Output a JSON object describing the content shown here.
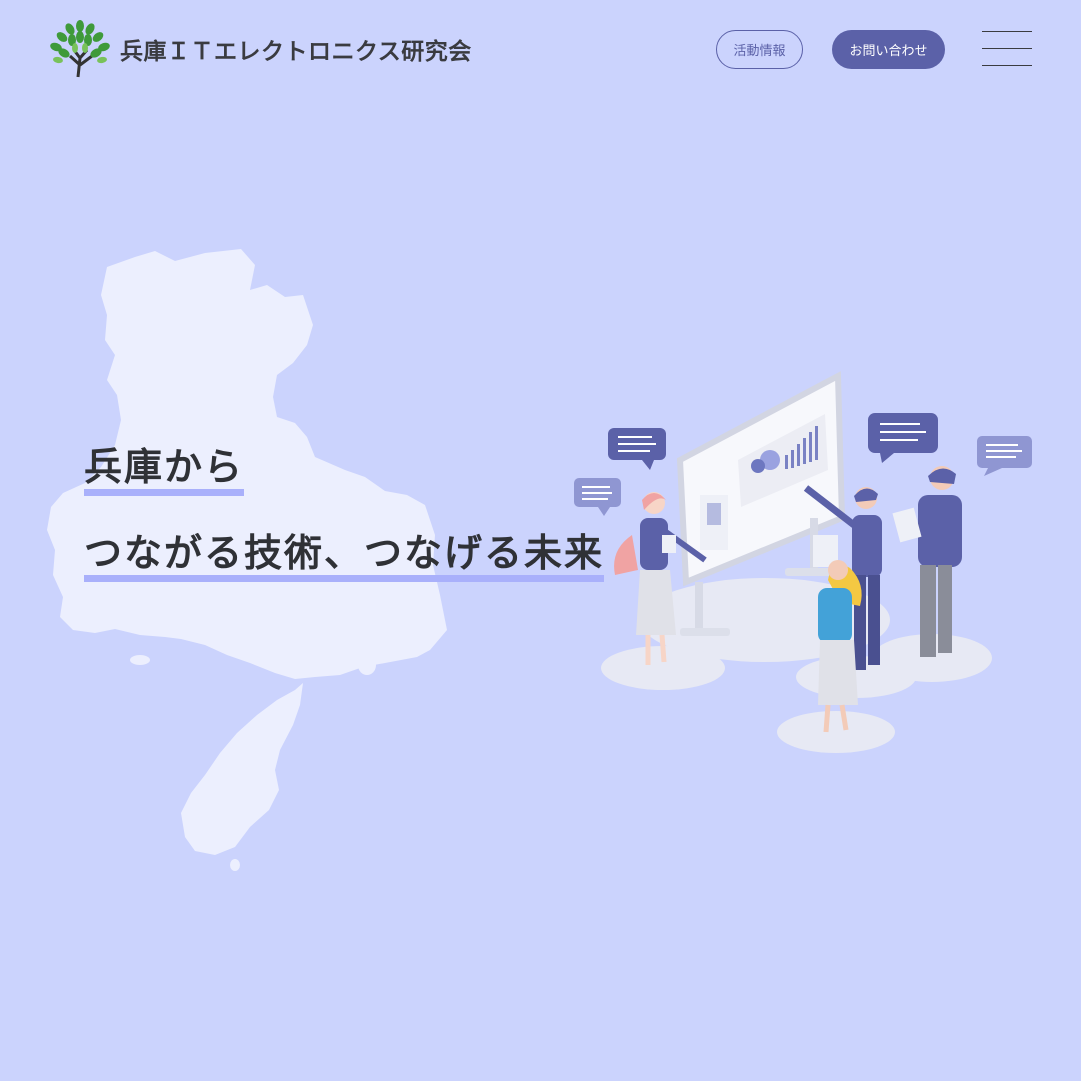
{
  "header": {
    "logo_text": "兵庫ＩＴエレクトロニクス研究会",
    "nav_activities": "活動情報",
    "nav_contact": "お問い合わせ"
  },
  "hero": {
    "line1": "兵庫から",
    "line2": "つながる技術、つなげる未来"
  },
  "colors": {
    "background": "#cbd3fd",
    "accent": "#5b61a8",
    "underline": "#a9b0fb",
    "map_fill": "#eceffe",
    "logo_green": "#3f9a3a"
  },
  "icons": [
    "tree-logo-icon",
    "hamburger-menu-icon",
    "hyogo-map-illustration",
    "team-presentation-illustration"
  ]
}
